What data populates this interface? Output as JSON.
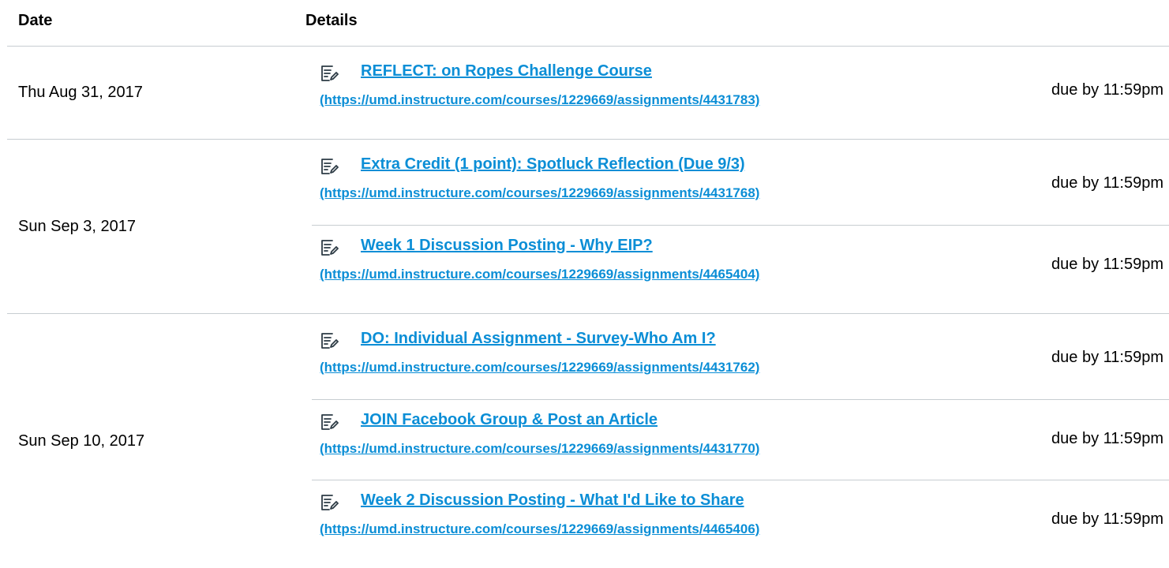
{
  "header": {
    "date_label": "Date",
    "details_label": "Details"
  },
  "groups": [
    {
      "date": "Thu Aug 31, 2017",
      "items": [
        {
          "icon": "assignment-icon",
          "title": "REFLECT: on Ropes Challenge Course",
          "url": "(https://umd.instructure.com/courses/1229669/assignments/4431783)",
          "due": "due by 11:59pm"
        }
      ]
    },
    {
      "date": "Sun Sep 3, 2017",
      "items": [
        {
          "icon": "assignment-icon",
          "title": "Extra Credit (1 point): Spotluck Reflection (Due 9/3)",
          "url": "(https://umd.instructure.com/courses/1229669/assignments/4431768)",
          "due": "due by 11:59pm"
        },
        {
          "icon": "assignment-icon",
          "title": "Week 1 Discussion Posting - Why EIP?",
          "url": "(https://umd.instructure.com/courses/1229669/assignments/4465404)",
          "due": "due by 11:59pm"
        }
      ]
    },
    {
      "date": "Sun Sep 10, 2017",
      "items": [
        {
          "icon": "assignment-icon",
          "title": "DO: Individual Assignment - Survey-Who Am I?",
          "url": "(https://umd.instructure.com/courses/1229669/assignments/4431762)",
          "due": "due by 11:59pm"
        },
        {
          "icon": "assignment-icon",
          "title": "JOIN Facebook Group & Post an Article",
          "url": "(https://umd.instructure.com/courses/1229669/assignments/4431770)",
          "due": "due by 11:59pm"
        },
        {
          "icon": "assignment-icon",
          "title": "Week 2 Discussion Posting - What I'd Like to Share",
          "url": "(https://umd.instructure.com/courses/1229669/assignments/4465406)",
          "due": "due by 11:59pm"
        }
      ]
    }
  ]
}
